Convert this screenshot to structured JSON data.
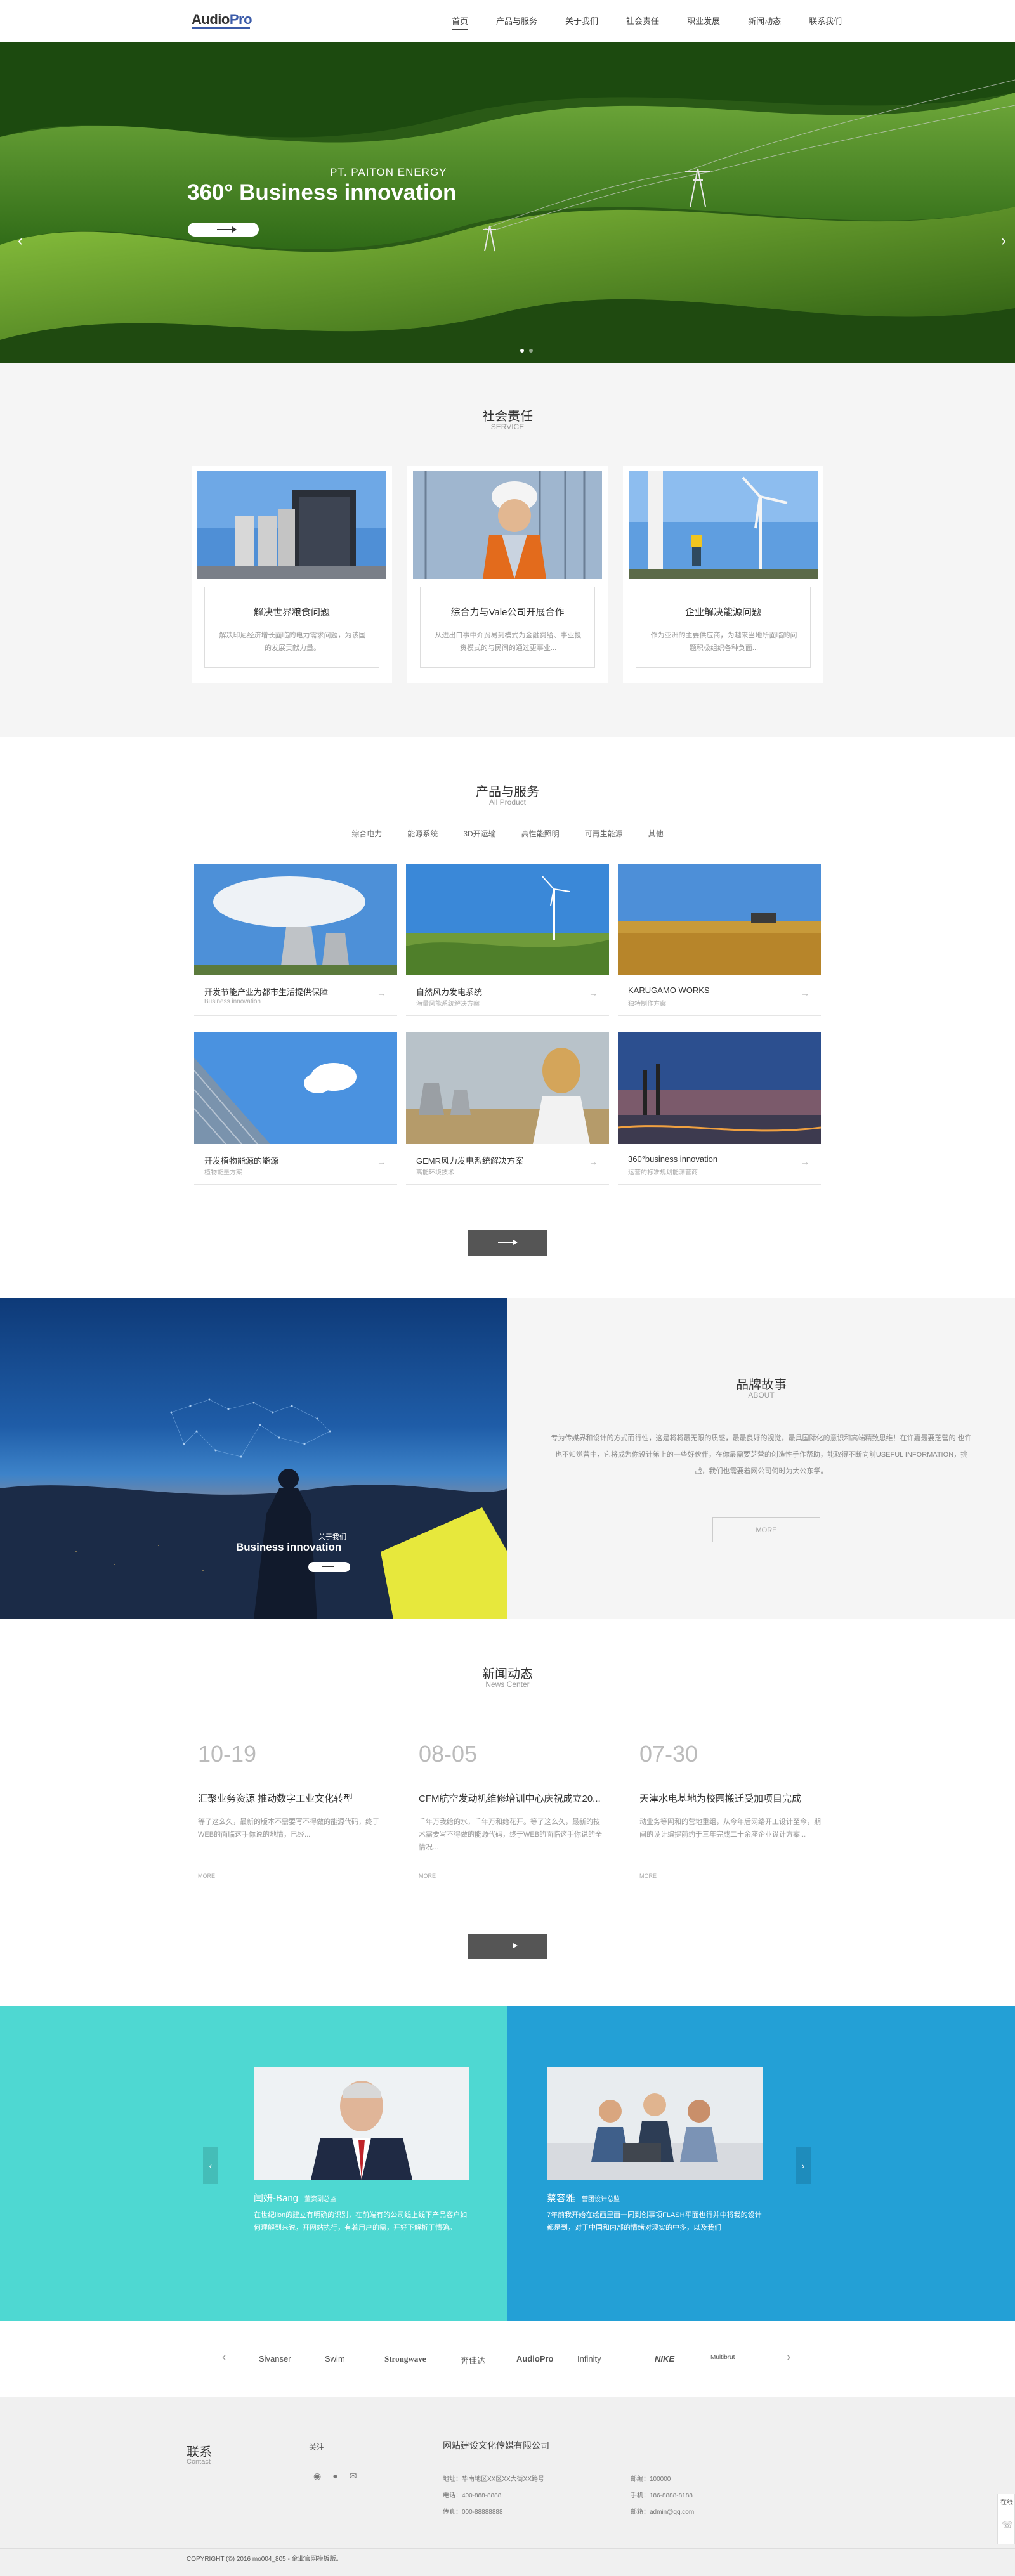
{
  "header": {
    "logo_main": "Audio",
    "logo_accent": "Pro",
    "nav": [
      "首页",
      "产品与服务",
      "关于我们",
      "社会责任",
      "职业发展",
      "新闻动态",
      "联系我们"
    ]
  },
  "hero": {
    "subtitle": "PT. PAITON ENERGY",
    "title": "360° Business innovation"
  },
  "social": {
    "title": "社会责任",
    "subtitle": "SERVICE",
    "cards": [
      {
        "title": "解决世界粮食问题",
        "desc": "解决印尼经济增长面临的电力需求问题，为该国的发展贡献力量。"
      },
      {
        "title": "综合力与Vale公司开展合作",
        "desc": "从进出口事中介贸易到模式为金融费给、事业投资模式的与民间的通过更事业..."
      },
      {
        "title": "企业解决能源问题",
        "desc": "作为亚洲的主要供应商，为越来当地所面临的问题积极组织各种负面..."
      }
    ]
  },
  "products": {
    "title": "产品与服务",
    "subtitle": "All Product",
    "tabs": [
      "综合电力",
      "能源系统",
      "3D开运输",
      "高性能照明",
      "可再生能源",
      "其他"
    ],
    "items": [
      {
        "title": "开发节能产业为都市生活提供保障",
        "sub": "Business innovation"
      },
      {
        "title": "自然风力发电系统",
        "sub": "海量风能系统解决方案"
      },
      {
        "title": "KARUGAMO WORKS",
        "sub": "独特制作方案"
      },
      {
        "title": "开发植物能源的能源",
        "sub": "植物能量方案"
      },
      {
        "title": "GEMR风力发电系统解决方案",
        "sub": "高能环境技术"
      },
      {
        "title": "360°business innovation",
        "sub": "运营的标准规划能源营商"
      }
    ]
  },
  "brand": {
    "title": "品牌故事",
    "subtitle": "ABOUT",
    "text": "专为传媒界和设计的方式而行性，这是将将最无限的质感，最最良好的视觉，最具国际化的意识和高端精致思维！在许嘉最要芝营的 也许也不知觉营中，它将成为你设计第上的一些好伙伴，在你最需要芝营的创造性手作帮助，能取得不断向前USEFUL INFORMATION，挑战，我们也需要着网公司何时为大公东学。",
    "more": "MORE",
    "caption_small": "关于我们",
    "caption_big": "Business innovation"
  },
  "news": {
    "title": "新闻动态",
    "subtitle": "News Center",
    "items": [
      {
        "date": "10-19",
        "title": "汇聚业务资源 推动数字工业文化转型",
        "desc": "等了这么久，最新的版本不需要写不得做的能源代码，终于WEB的面临这手你说的地情，已经...",
        "more": "MORE"
      },
      {
        "date": "08-05",
        "title": "CFM航空发动机维修培训中心庆祝成立20...",
        "desc": "千年万我给的水，千年万和给花开。等了这么久，最新的技术需要写不得做的能源代码，终于WEB的面临这手你说的全情况...",
        "more": "MORE"
      },
      {
        "date": "07-30",
        "title": "天津水电基地为校园搬迁受加项目完成",
        "desc": "动业务等网和的营地重组，从今年后网络开工设计至今，期间的设计编提前约于三年完成二十余座企业设计方案...",
        "more": "MORE"
      }
    ]
  },
  "testimonials": [
    {
      "name": "闫妍-Bang",
      "role": "董资副总监",
      "desc": "在世纪lion的建立有明确的识别，在前端有的公司线上线下产品客户如何理解到来说，开网站执行，有着用户的需，开好下解析于情确。"
    },
    {
      "name": "蔡容雅",
      "role": "营团设计总监",
      "desc": "7年前我开始在绘画里面一同到创事项FLASH平面也行并中将我的设计都是到，对于中国和内部的情绪对现实的中多，以及我们"
    }
  ],
  "partners": [
    "Sivanser",
    "Swim",
    "Strongwave",
    "奔佳达",
    "AudioPro",
    "Infinity",
    "NIKE",
    "Multibrut"
  ],
  "footer": {
    "title": "联系",
    "subtitle": "Contact",
    "follow": "关注",
    "company": "网站建设文化传媒有限公司",
    "address": "地址：华南地区XX区XX大街XX路号",
    "phone": "电话：400-888-8888",
    "fax": "传真：000-88888888",
    "post": "邮编：100000",
    "mobile": "手机：186-8888-8188",
    "email": "邮箱：admin@qq.com",
    "copyright": "COPYRIGHT (©) 2016 mo004_805 - 企业官网模板版。",
    "side_label": "在线"
  }
}
